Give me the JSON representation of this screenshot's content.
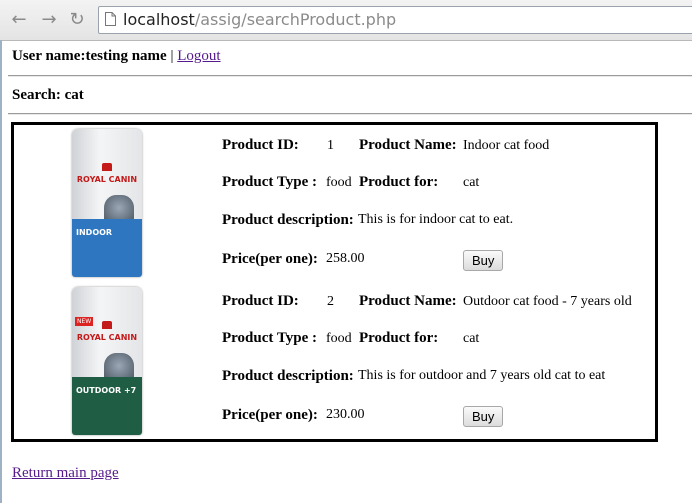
{
  "browser": {
    "url_host": "localhost",
    "url_path": "/assig/searchProduct.php",
    "back_icon": "arrow-left-icon",
    "forward_icon": "arrow-right-icon",
    "reload_icon": "reload-icon"
  },
  "header": {
    "user_label": "User name:",
    "user_name": "testing name",
    "separator": " | ",
    "logout_label": "Logout"
  },
  "search": {
    "label": "Search:",
    "term": "cat"
  },
  "labels": {
    "product_id": "Product ID:",
    "product_name": "Product Name:",
    "product_type": "Product Type :",
    "product_for": "Product for:",
    "product_description": "Product description:",
    "price": "Price(per one):",
    "buy": "Buy"
  },
  "products": [
    {
      "id": "1",
      "name": "Indoor cat food",
      "type": "food",
      "for": "cat",
      "description": "This is for indoor cat to eat.",
      "price": "258.00",
      "image_brand": "ROYAL CANIN",
      "image_variant": "INDOOR",
      "image_color": "#2e77c0"
    },
    {
      "id": "2",
      "name": "Outdoor cat food - 7 years old",
      "type": "food",
      "for": "cat",
      "description": "This is for outdoor and 7 years old cat to eat",
      "price": "230.00",
      "image_brand": "ROYAL CANIN",
      "image_variant": "OUTDOOR +7",
      "image_badge": "NEW",
      "image_color": "#1f5e44"
    }
  ],
  "footer": {
    "return_label": "Return main page"
  }
}
